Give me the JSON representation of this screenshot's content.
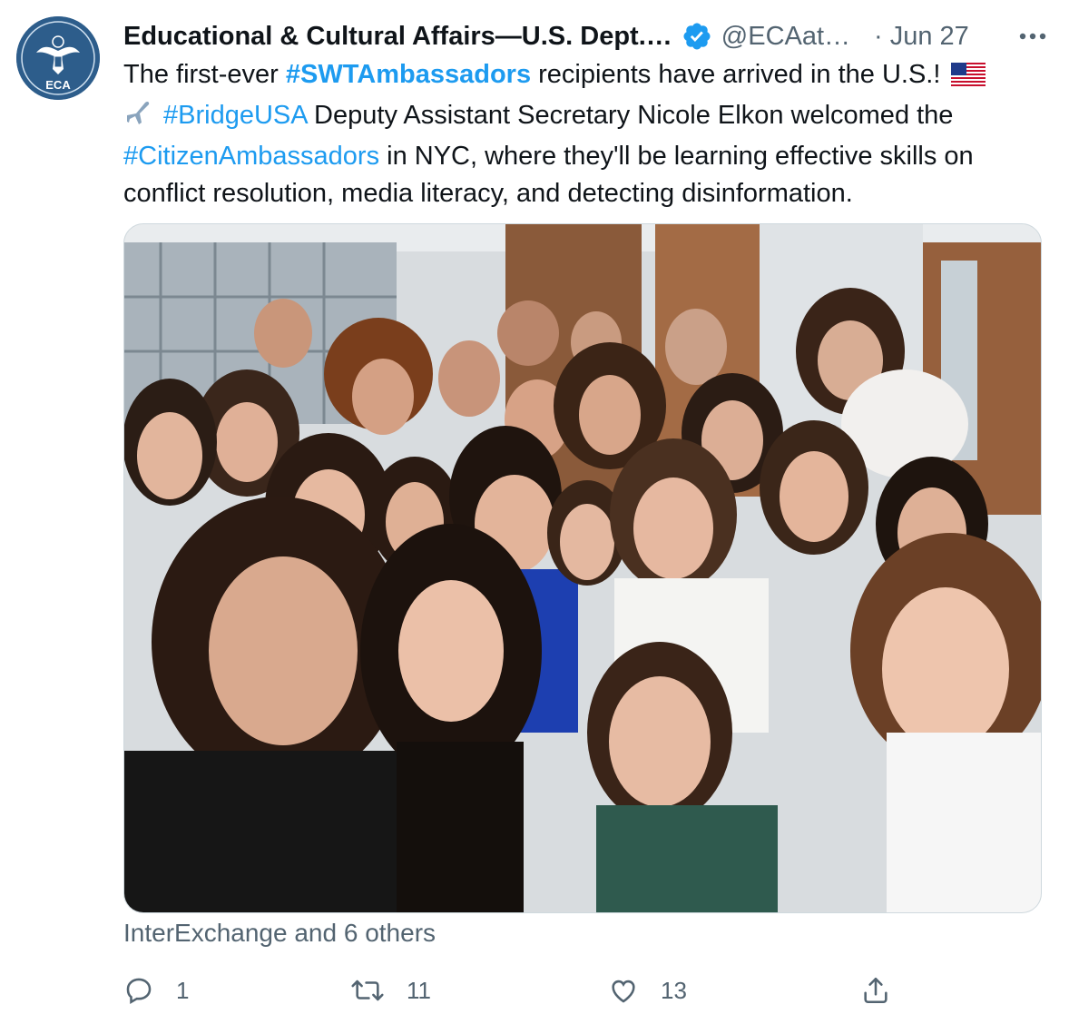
{
  "account": {
    "display_name": "Educational & Cultural Affairs—U.S. Dept.…",
    "handle": "@ECAat…",
    "separator": "·",
    "date": "Jun 27",
    "avatar_label": "ECA",
    "verified_icon": "verified-badge-icon"
  },
  "tweet": {
    "t1": "The first-ever ",
    "h1": "#SWTAmbassadors",
    "t2": " recipients have arrived in the U.S.! ",
    "h2": "#BridgeUSA",
    "t3": " Deputy Assistant Secretary Nicole Elkon welcomed the ",
    "h3": "#CitizenAmbassadors",
    "t4": " in NYC, where they'll be learning effective skills on conflict resolution, media literacy, and detecting disinformation.",
    "flag_icon": "us-flag-emoji",
    "plane_icon": "airplane-emoji"
  },
  "tags": "InterExchange and 6 others",
  "actions": {
    "reply_count": "1",
    "retweet_count": "11",
    "like_count": "13"
  },
  "colors": {
    "accent": "#1d9bf0",
    "text": "#0f1419",
    "muted": "#536471"
  }
}
